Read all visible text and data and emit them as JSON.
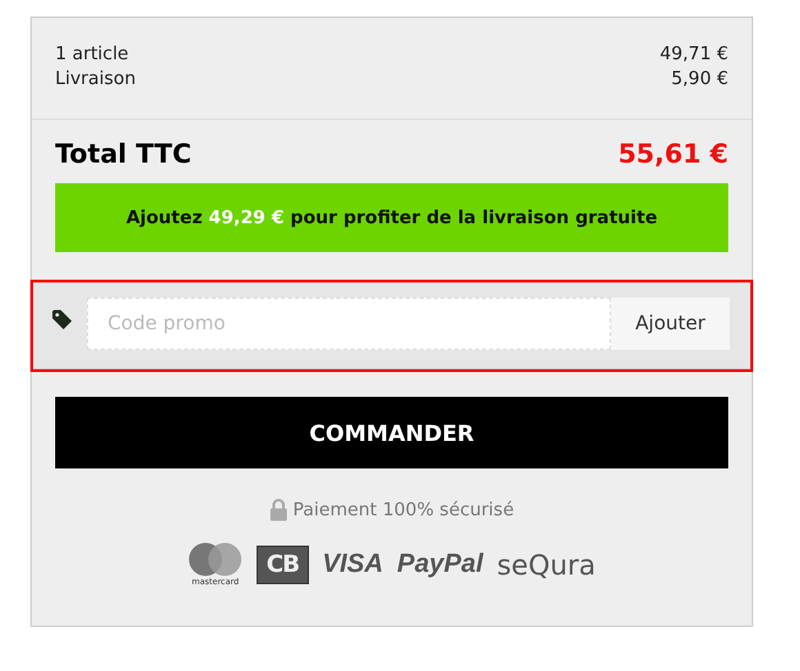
{
  "summary": [
    {
      "label": "1 article",
      "value": "49,71 €"
    },
    {
      "label": "Livraison",
      "value": "5,90 €"
    }
  ],
  "total": {
    "label": "Total TTC",
    "value": "55,61 €"
  },
  "shipping_banner": "Ajoutez **49,29 €** pour profiter de la livraison gratuite",
  "promo": {
    "highlighted": true,
    "placeholder": "Code promo",
    "button": "Ajouter"
  },
  "checkout_button": "COMMANDER",
  "secure_note": "Paiement 100% sécurisé",
  "payment_logos": [
    {
      "kind": "mastercard",
      "text": "mastercard"
    },
    {
      "kind": "cb",
      "text": "CB"
    },
    {
      "kind": "visa",
      "text": "VISA"
    },
    {
      "kind": "paypal",
      "text": "PayPal"
    },
    {
      "kind": "sequra",
      "text": "seQura"
    }
  ]
}
